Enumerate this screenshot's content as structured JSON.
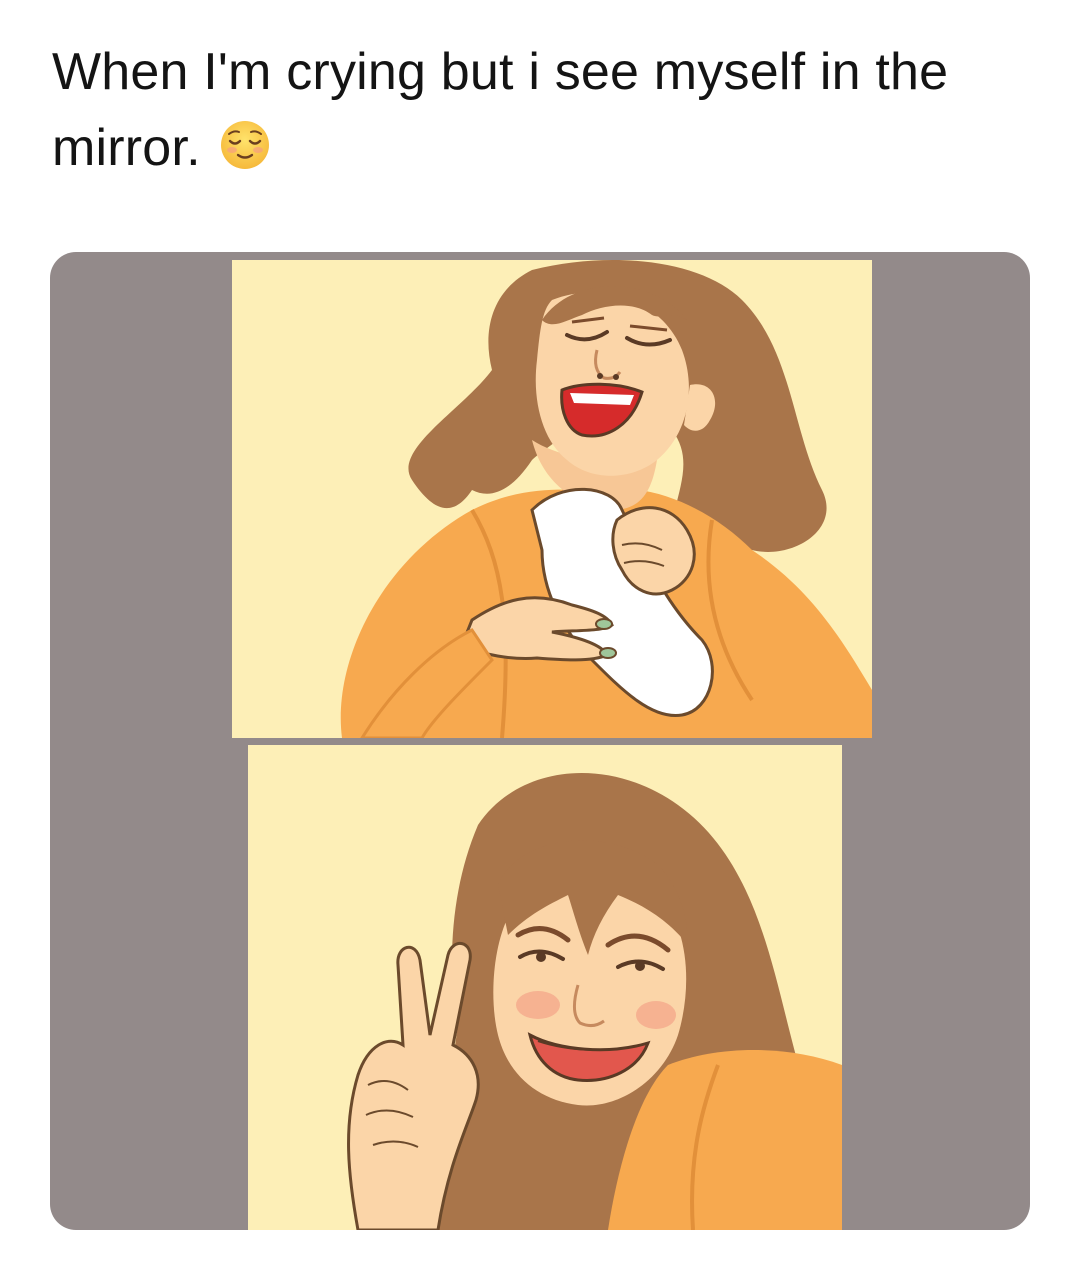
{
  "post": {
    "caption": "When I'm crying but i see myself in the mirror.",
    "emoji": "relieved-face-emoji"
  },
  "meme": {
    "panels": [
      {
        "scene": "woman-crying-holding-tissue"
      },
      {
        "scene": "woman-smiling-peace-sign"
      }
    ]
  },
  "colors": {
    "card_background": "#938a8a",
    "panel_background": "#fdefb7",
    "hair": "#a9754a",
    "skin": "#fbd5a8",
    "shirt": "#f7a94f"
  }
}
